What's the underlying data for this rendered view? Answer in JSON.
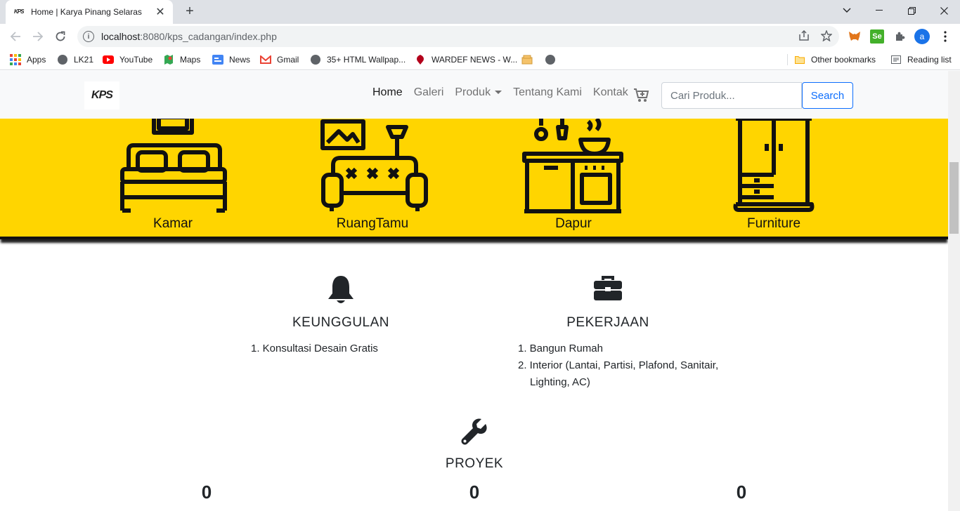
{
  "browser": {
    "tab_title": "Home | Karya Pinang Selaras",
    "tab_favicon_text": "KPS",
    "url_host": "localhost",
    "url_rest": ":8080/kps_cadangan/index.php",
    "profile_initial": "a",
    "extensions": [
      "metamask-icon",
      "selenium-icon",
      "puzzle-icon"
    ],
    "bookmarks": [
      {
        "label": "Apps",
        "icon": "apps-grid-icon"
      },
      {
        "label": "LK21",
        "icon": "globe-icon"
      },
      {
        "label": "YouTube",
        "icon": "youtube-icon"
      },
      {
        "label": "Maps",
        "icon": "maps-icon"
      },
      {
        "label": "News",
        "icon": "news-icon"
      },
      {
        "label": "Gmail",
        "icon": "gmail-icon"
      },
      {
        "label": "35+ HTML Wallpap...",
        "icon": "globe-icon"
      },
      {
        "label": "WARDEF NEWS - W...",
        "icon": "wardef-icon"
      }
    ],
    "other_bookmarks": "Other bookmarks",
    "reading_list": "Reading list"
  },
  "navbar": {
    "brand": "KPS",
    "links": [
      "Home",
      "Galeri",
      "Produk",
      "Tentang Kami",
      "Kontak"
    ],
    "search_placeholder": "Cari Produk...",
    "search_button": "Search"
  },
  "categories": [
    "Kamar",
    "RuangTamu",
    "Dapur",
    "Furniture"
  ],
  "features": {
    "keunggulan": {
      "title": "KEUNGGULAN",
      "items": [
        "1. Konsultasi Desain Gratis"
      ]
    },
    "pekerjaan": {
      "title": "PEKERJAAN",
      "items": [
        "1. Bangun Rumah",
        "2. Interior (Lantai, Partisi, Plafond, Sanitair,",
        "Lighting, AC)"
      ]
    },
    "proyek": {
      "title": "PROYEK"
    }
  },
  "counters": [
    "0",
    "0",
    "0"
  ],
  "colors": {
    "accent_yellow": "#ffd500",
    "link_blue": "#0d6efd",
    "navbar_bg": "#f8f9fa"
  }
}
